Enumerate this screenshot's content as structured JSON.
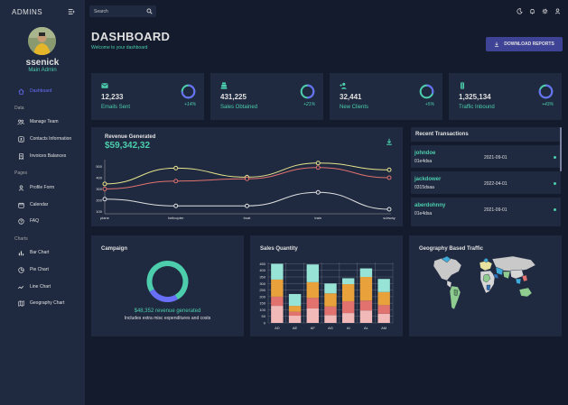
{
  "sidebar": {
    "brand": "ADMINS",
    "user": {
      "name": "ssenick",
      "role": "Main Admin"
    },
    "items": [
      {
        "label": "Dashboard",
        "icon": "home-icon",
        "active": true
      },
      {
        "section": "Data"
      },
      {
        "label": "Manage Team",
        "icon": "people-icon"
      },
      {
        "label": "Contacts Information",
        "icon": "contacts-icon"
      },
      {
        "label": "Invoices Balances",
        "icon": "receipt-icon"
      },
      {
        "section": "Pages"
      },
      {
        "label": "Profile Form",
        "icon": "person-icon"
      },
      {
        "label": "Calendar",
        "icon": "calendar-icon"
      },
      {
        "label": "FAQ",
        "icon": "help-icon"
      },
      {
        "section": "Charts"
      },
      {
        "label": "Bar Chart",
        "icon": "bar-chart-icon"
      },
      {
        "label": "Pie Chart",
        "icon": "pie-chart-icon"
      },
      {
        "label": "Line Chart",
        "icon": "timeline-icon"
      },
      {
        "label": "Geography Chart",
        "icon": "map-icon"
      }
    ]
  },
  "topbar": {
    "search_placeholder": "Search"
  },
  "header": {
    "title": "DASHBOARD",
    "subtitle": "Welcome to your dashboard",
    "download_label": "DOWNLOAD REPORTS"
  },
  "stats": [
    {
      "value": "12,233",
      "label": "Emails Sent",
      "increase": "+14%",
      "progress": 0.75,
      "icon": "email-icon"
    },
    {
      "value": "431,225",
      "label": "Sales Obtained",
      "increase": "+21%",
      "progress": 0.5,
      "icon": "point-of-sale-icon"
    },
    {
      "value": "32,441",
      "label": "New Clients",
      "increase": "+5%",
      "progress": 0.3,
      "icon": "person-add-icon"
    },
    {
      "value": "1,325,134",
      "label": "Traffic Inbound",
      "increase": "+43%",
      "progress": 0.8,
      "icon": "traffic-icon"
    }
  ],
  "revenue": {
    "title": "Revenue Generated",
    "value": "$59,342,32"
  },
  "transactions": {
    "title": "Recent Transactions",
    "rows": [
      {
        "txId": "johndoe",
        "user": "01e4dsa",
        "date": "2021-09-01"
      },
      {
        "txId": "jackdower",
        "user": "0315dsaa",
        "date": "2022-04-01"
      },
      {
        "txId": "aberdohnny",
        "user": "01e4dsa",
        "date": "2021-09-01"
      }
    ]
  },
  "campaign": {
    "title": "Campaign",
    "revenue": "$48,352 revenue generated",
    "note": "Includes extra misc expenditures and costs"
  },
  "sales": {
    "title": "Sales Quantity"
  },
  "geo": {
    "title": "Geography Based Traffic"
  },
  "colors": {
    "accent": "#4cceac",
    "primary": "#6870fa",
    "panel": "#1f2a40",
    "background": "#141b2d",
    "button": "#3e4396"
  },
  "chart_data": [
    {
      "type": "line",
      "x": [
        "plane",
        "helicopter",
        "boat",
        "train",
        "subway"
      ],
      "series": [
        {
          "color": "#e8e58c",
          "values": [
            345,
            485,
            405,
            530,
            470
          ]
        },
        {
          "color": "#e2726e",
          "values": [
            300,
            370,
            390,
            490,
            400
          ]
        },
        {
          "color": "#e0e0e0",
          "values": [
            210,
            150,
            150,
            270,
            120
          ]
        }
      ],
      "yticks": [
        100,
        200,
        300,
        400,
        500
      ],
      "ylim": [
        80,
        560
      ]
    },
    {
      "type": "pie",
      "values": [
        75,
        25
      ],
      "colors": [
        "#4cceac",
        "#6870fa"
      ]
    },
    {
      "type": "bar",
      "categories": [
        "AD",
        "AE",
        "AF",
        "AG",
        "AI",
        "AL",
        "AM"
      ],
      "stacked": true,
      "series": [
        {
          "color": "#f1b9b7",
          "values": [
            130,
            55,
            110,
            60,
            75,
            95,
            70
          ]
        },
        {
          "color": "#e2726e",
          "values": [
            70,
            30,
            80,
            65,
            90,
            75,
            65
          ]
        },
        {
          "color": "#e9a23b",
          "values": [
            130,
            45,
            120,
            100,
            130,
            180,
            100
          ]
        },
        {
          "color": "#97e3d5",
          "values": [
            120,
            90,
            135,
            75,
            45,
            65,
            100
          ]
        }
      ],
      "yticks": [
        0,
        50,
        100,
        150,
        200,
        250,
        300,
        350,
        400,
        450
      ],
      "ylim": [
        0,
        460
      ]
    }
  ]
}
